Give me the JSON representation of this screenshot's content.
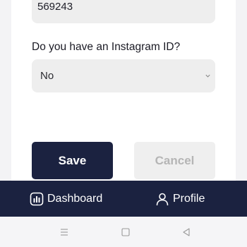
{
  "form": {
    "phone_value": "569243",
    "instagram_question": "Do you have an Instagram ID?",
    "instagram_select": {
      "selected": "No"
    }
  },
  "actions": {
    "save_label": "Save",
    "cancel_label": "Cancel"
  },
  "bottom_nav": {
    "items": [
      {
        "label": "Dashboard",
        "icon": "chart-icon"
      },
      {
        "label": "Profile",
        "icon": "user-icon"
      }
    ]
  },
  "system_nav": {
    "icons": [
      "menu-icon",
      "home-icon",
      "back-icon"
    ]
  },
  "colors": {
    "primary": "#1b2240",
    "field_bg": "#eeeeee",
    "cancel_text": "#b5b5b5"
  }
}
